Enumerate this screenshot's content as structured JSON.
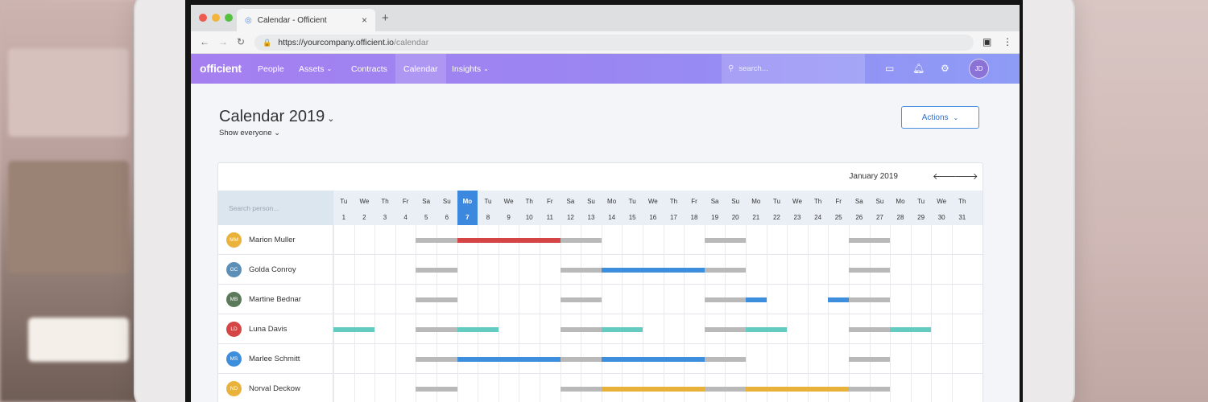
{
  "browser": {
    "tab_title": "Calendar - Officient",
    "url_prefix": "https://",
    "url_host": "yourcompany.officient.io",
    "url_path": "/calendar"
  },
  "nav": {
    "logo": "officient",
    "items": [
      {
        "label": "People",
        "caret": false
      },
      {
        "label": "Assets",
        "caret": true
      },
      {
        "label": "Contracts",
        "caret": false
      },
      {
        "label": "Calendar",
        "caret": false,
        "active": true
      },
      {
        "label": "Insights",
        "caret": true
      }
    ],
    "search_placeholder": "search...",
    "avatar": "JD"
  },
  "page": {
    "title": "Calendar 2019",
    "filter": "Show everyone",
    "actions_label": "Actions"
  },
  "calendar": {
    "month_label": "January 2019",
    "search_placeholder": "Search person...",
    "today_day": 7,
    "days": [
      {
        "wd": "Tu",
        "d": 1
      },
      {
        "wd": "We",
        "d": 2
      },
      {
        "wd": "Th",
        "d": 3
      },
      {
        "wd": "Fr",
        "d": 4
      },
      {
        "wd": "Sa",
        "d": 5
      },
      {
        "wd": "Su",
        "d": 6
      },
      {
        "wd": "Mo",
        "d": 7
      },
      {
        "wd": "Tu",
        "d": 8
      },
      {
        "wd": "We",
        "d": 9
      },
      {
        "wd": "Th",
        "d": 10
      },
      {
        "wd": "Fr",
        "d": 11
      },
      {
        "wd": "Sa",
        "d": 12
      },
      {
        "wd": "Su",
        "d": 13
      },
      {
        "wd": "Mo",
        "d": 14
      },
      {
        "wd": "Tu",
        "d": 15
      },
      {
        "wd": "We",
        "d": 16
      },
      {
        "wd": "Th",
        "d": 17
      },
      {
        "wd": "Fr",
        "d": 18
      },
      {
        "wd": "Sa",
        "d": 19
      },
      {
        "wd": "Su",
        "d": 20
      },
      {
        "wd": "Mo",
        "d": 21
      },
      {
        "wd": "Tu",
        "d": 22
      },
      {
        "wd": "We",
        "d": 23
      },
      {
        "wd": "Th",
        "d": 24
      },
      {
        "wd": "Fr",
        "d": 25
      },
      {
        "wd": "Sa",
        "d": 26
      },
      {
        "wd": "Su",
        "d": 27
      },
      {
        "wd": "Mo",
        "d": 28
      },
      {
        "wd": "Tu",
        "d": 29
      },
      {
        "wd": "We",
        "d": 30
      },
      {
        "wd": "Th",
        "d": 31
      }
    ],
    "colors": {
      "weekend": "#b9b9b9",
      "holiday": "#d64545",
      "leave": "#3d8fde",
      "training": "#63cbc0",
      "remote": "#e8b23a"
    },
    "people": [
      {
        "initials": "MM",
        "name": "Marion Muller",
        "avatar_color": "#e9b23a",
        "events": [
          {
            "start": 5,
            "end": 6,
            "type": "weekend"
          },
          {
            "start": 7,
            "end": 11,
            "type": "holiday"
          },
          {
            "start": 12,
            "end": 13,
            "type": "weekend"
          },
          {
            "start": 19,
            "end": 20,
            "type": "weekend"
          },
          {
            "start": 26,
            "end": 27,
            "type": "weekend"
          }
        ]
      },
      {
        "initials": "GC",
        "name": "Golda Conroy",
        "avatar_color": "#5c8fb8",
        "events": [
          {
            "start": 5,
            "end": 6,
            "type": "weekend"
          },
          {
            "start": 12,
            "end": 13,
            "type": "weekend"
          },
          {
            "start": 14,
            "end": 18,
            "type": "leave"
          },
          {
            "start": 19,
            "end": 20,
            "type": "weekend"
          },
          {
            "start": 26,
            "end": 27,
            "type": "weekend"
          }
        ]
      },
      {
        "initials": "MB",
        "name": "Martine Bednar",
        "avatar_color": "#5a7a5a",
        "events": [
          {
            "start": 5,
            "end": 6,
            "type": "weekend"
          },
          {
            "start": 12,
            "end": 13,
            "type": "weekend"
          },
          {
            "start": 19,
            "end": 20,
            "type": "weekend"
          },
          {
            "start": 21,
            "end": 21,
            "type": "leave"
          },
          {
            "start": 25,
            "end": 25,
            "type": "leave"
          },
          {
            "start": 26,
            "end": 27,
            "type": "weekend"
          }
        ]
      },
      {
        "initials": "LD",
        "name": "Luna Davis",
        "avatar_color": "#d64545",
        "events": [
          {
            "start": 1,
            "end": 2,
            "type": "training"
          },
          {
            "start": 5,
            "end": 6,
            "type": "weekend"
          },
          {
            "start": 7,
            "end": 8,
            "type": "training"
          },
          {
            "start": 12,
            "end": 13,
            "type": "weekend"
          },
          {
            "start": 14,
            "end": 15,
            "type": "training"
          },
          {
            "start": 19,
            "end": 20,
            "type": "weekend"
          },
          {
            "start": 21,
            "end": 22,
            "type": "training"
          },
          {
            "start": 26,
            "end": 27,
            "type": "weekend"
          },
          {
            "start": 28,
            "end": 29,
            "type": "training"
          }
        ]
      },
      {
        "initials": "MS",
        "name": "Marlee Schmitt",
        "avatar_color": "#3d8fde",
        "events": [
          {
            "start": 5,
            "end": 6,
            "type": "weekend"
          },
          {
            "start": 7,
            "end": 11,
            "type": "leave"
          },
          {
            "start": 12,
            "end": 13,
            "type": "weekend"
          },
          {
            "start": 14,
            "end": 18,
            "type": "leave"
          },
          {
            "start": 19,
            "end": 20,
            "type": "weekend"
          },
          {
            "start": 26,
            "end": 27,
            "type": "weekend"
          }
        ]
      },
      {
        "initials": "ND",
        "name": "Norval Deckow",
        "avatar_color": "#e9b23a",
        "events": [
          {
            "start": 5,
            "end": 6,
            "type": "weekend"
          },
          {
            "start": 12,
            "end": 13,
            "type": "weekend"
          },
          {
            "start": 14,
            "end": 18,
            "type": "remote"
          },
          {
            "start": 19,
            "end": 20,
            "type": "weekend"
          },
          {
            "start": 21,
            "end": 25,
            "type": "remote"
          },
          {
            "start": 26,
            "end": 27,
            "type": "weekend"
          }
        ]
      }
    ]
  }
}
